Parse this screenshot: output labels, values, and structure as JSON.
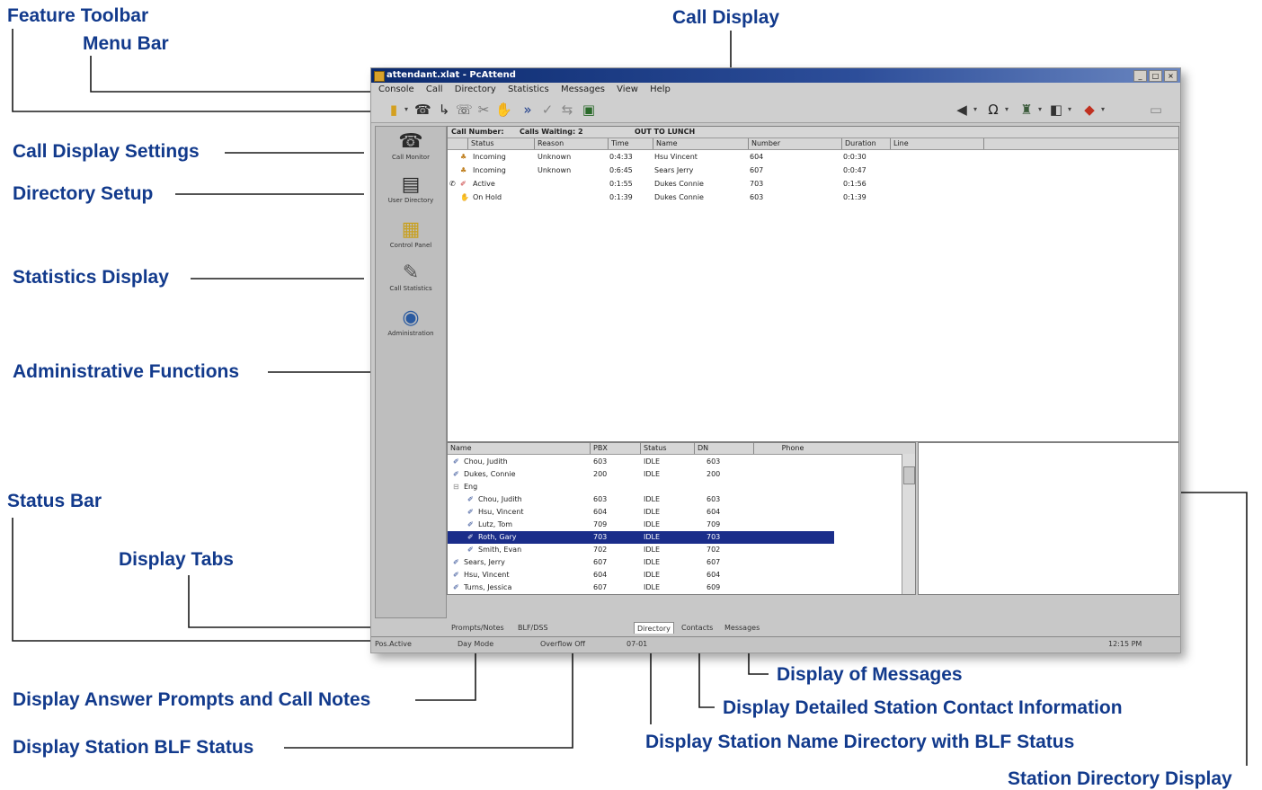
{
  "callouts": {
    "feature_toolbar": "Feature Toolbar",
    "menu_bar": "Menu Bar",
    "call_display": "Call Display",
    "call_display_settings": "Call Display Settings",
    "directory_setup": "Directory Setup",
    "statistics_display": "Statistics Display",
    "administrative_functions": "Administrative Functions",
    "status_bar": "Status Bar",
    "display_tabs": "Display Tabs",
    "display_of_messages": "Display of Messages",
    "display_answer_prompts": "Display Answer Prompts and Call Notes",
    "display_detailed_station_contact": "Display Detailed Station Contact Information",
    "display_station_blf_status": "Display Station BLF Status",
    "display_station_name_directory": "Display Station Name Directory with BLF Status",
    "station_directory_display": "Station Directory Display"
  },
  "window": {
    "title": "attendant.xlat - PcAttend",
    "menu": [
      "Console",
      "Call",
      "Directory",
      "Statistics",
      "Messages",
      "View",
      "Help"
    ]
  },
  "toolbar": {
    "icons": [
      "receiver-icon",
      "phone-book-icon",
      "transfer-icon",
      "conference-icon",
      "release-icon",
      "hold-icon",
      "forward-icon",
      "check-icon",
      "swap-icon",
      "monitor-icon",
      "speaker-icon",
      "headset-icon",
      "user-icon",
      "night-icon",
      "alarm-icon",
      "close-icon"
    ]
  },
  "sidebar": {
    "items": [
      {
        "label": "Call Monitor",
        "icon": "phone-icon"
      },
      {
        "label": "User Directory",
        "icon": "directory-icon"
      },
      {
        "label": "Control Panel",
        "icon": "control-panel-icon"
      },
      {
        "label": "Call Statistics",
        "icon": "statistics-icon"
      },
      {
        "label": "Administration",
        "icon": "administration-icon"
      }
    ]
  },
  "call_display": {
    "call_number_label": "Call Number:",
    "calls_waiting": "Calls Waiting: 2",
    "status_text": "OUT TO LUNCH",
    "columns": [
      "Status",
      "Reason",
      "Time",
      "Name",
      "Number",
      "Duration",
      "Line"
    ],
    "rows": [
      {
        "status": "Incoming",
        "reason": "Unknown",
        "time": "0:4:33",
        "name": "Hsu Vincent",
        "number": "604",
        "duration": "0:0:30"
      },
      {
        "status": "Incoming",
        "reason": "Unknown",
        "time": "0:6:45",
        "name": "Sears Jerry",
        "number": "607",
        "duration": "0:0:47"
      },
      {
        "status": "Active",
        "reason": "",
        "time": "0:1:55",
        "name": "Dukes Connie",
        "number": "703",
        "duration": "0:1:56"
      },
      {
        "status": "On Hold",
        "reason": "",
        "time": "0:1:39",
        "name": "Dukes Connie",
        "number": "603",
        "duration": "0:1:39"
      }
    ]
  },
  "directory": {
    "columns": [
      "Name",
      "PBX",
      "Status",
      "DN",
      "Phone"
    ],
    "rows": [
      {
        "name": "Chou, Judith",
        "pbx": "603",
        "status": "IDLE",
        "dn": "603",
        "indent": 0
      },
      {
        "name": "Dukes, Connie",
        "pbx": "200",
        "status": "IDLE",
        "dn": "200",
        "indent": 0
      },
      {
        "name": "Eng",
        "pbx": "",
        "status": "",
        "dn": "",
        "indent": 0
      },
      {
        "name": "Chou, Judith",
        "pbx": "603",
        "status": "IDLE",
        "dn": "603",
        "indent": 1
      },
      {
        "name": "Hsu, Vincent",
        "pbx": "604",
        "status": "IDLE",
        "dn": "604",
        "indent": 1
      },
      {
        "name": "Lutz, Tom",
        "pbx": "709",
        "status": "IDLE",
        "dn": "709",
        "indent": 1
      },
      {
        "name": "Roth, Gary",
        "pbx": "703",
        "status": "IDLE",
        "dn": "703",
        "indent": 1,
        "selected": true
      },
      {
        "name": "Smith, Evan",
        "pbx": "702",
        "status": "IDLE",
        "dn": "702",
        "indent": 1
      },
      {
        "name": "Sears, Jerry",
        "pbx": "607",
        "status": "IDLE",
        "dn": "607",
        "indent": 0
      },
      {
        "name": "Hsu, Vincent",
        "pbx": "604",
        "status": "IDLE",
        "dn": "604",
        "indent": 0
      },
      {
        "name": "Turns, Jessica",
        "pbx": "607",
        "status": "IDLE",
        "dn": "609",
        "indent": 0
      }
    ]
  },
  "tabs": [
    "Prompts/Notes",
    "BLF/DSS",
    "Directory",
    "Contacts",
    "Messages"
  ],
  "active_tab": "Directory",
  "statusbar": {
    "mode": "Pos.Active",
    "day_mode": "Day Mode",
    "overflow": "Overflow Off",
    "ext": "07-01",
    "time": "12:15 PM"
  }
}
